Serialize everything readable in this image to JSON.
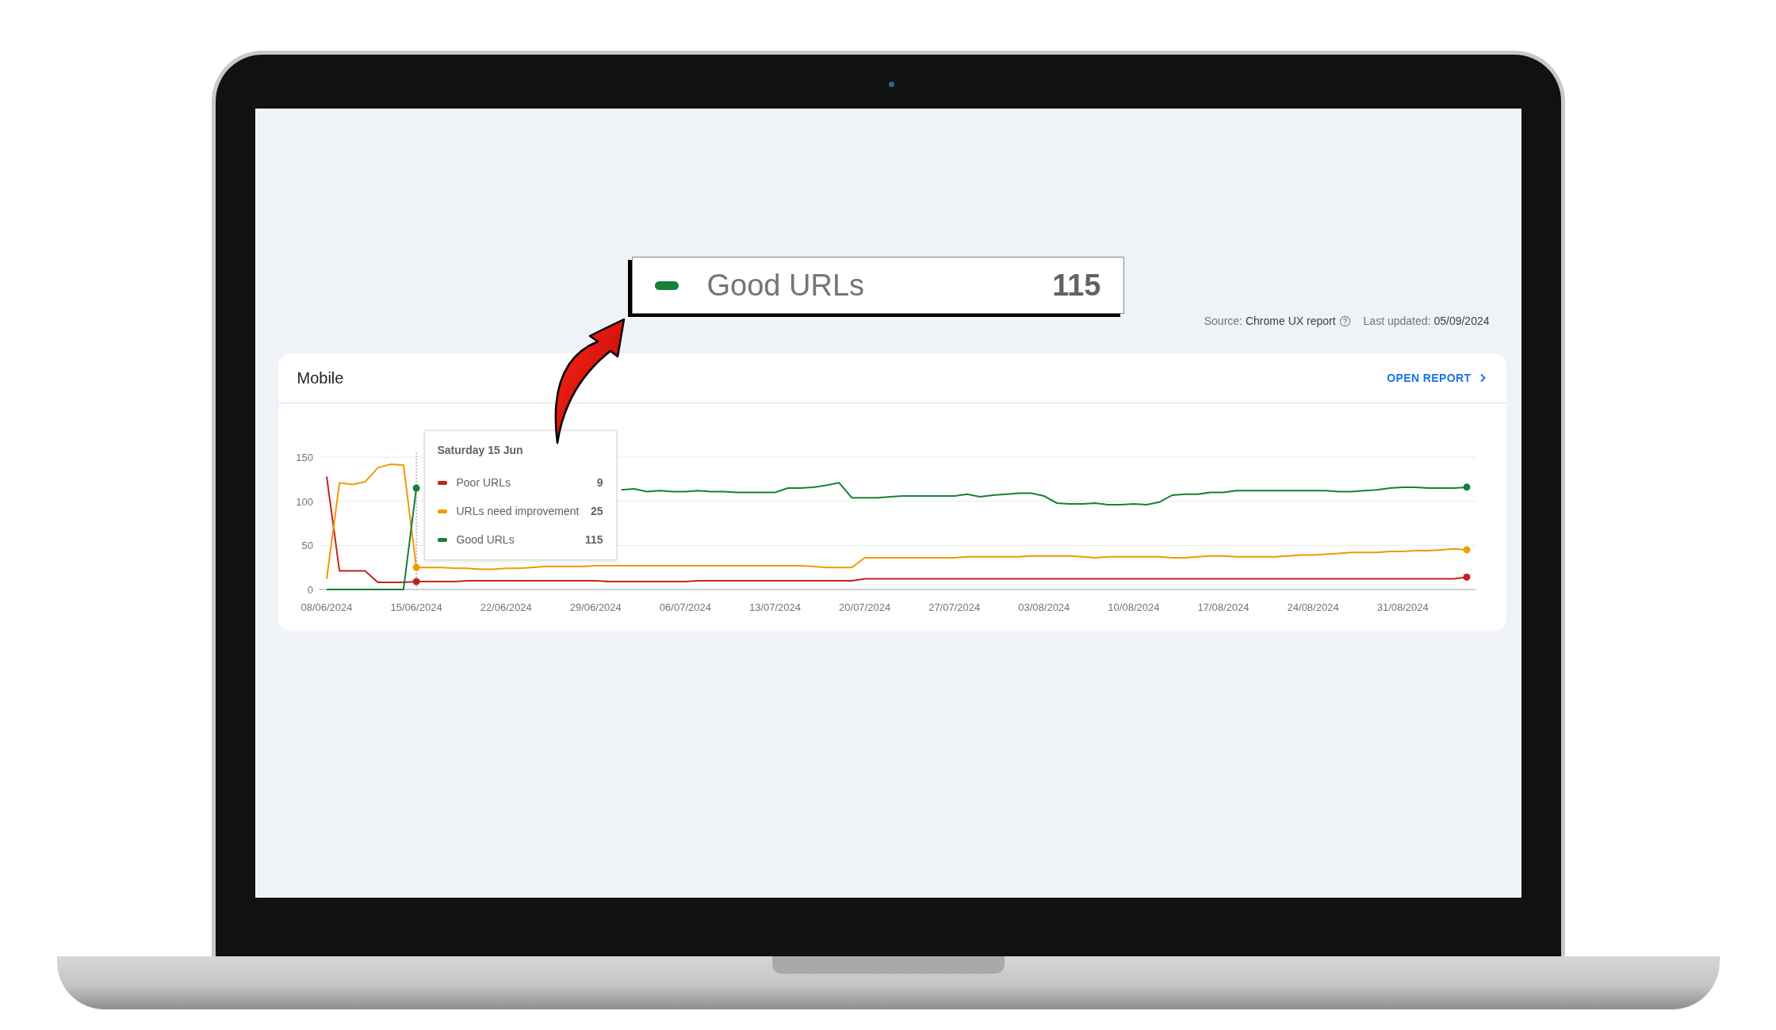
{
  "callout": {
    "label": "Good URLs",
    "value": "115"
  },
  "source": {
    "label": "Source:",
    "value": "Chrome UX report"
  },
  "updated": {
    "label": "Last updated:",
    "value": "05/09/2024"
  },
  "card": {
    "title": "Mobile",
    "link": "OPEN REPORT",
    "chart_data": {
      "type": "line",
      "categories": [
        "08/06/2024",
        null,
        null,
        null,
        null,
        null,
        null,
        "15/06/2024",
        null,
        null,
        null,
        null,
        null,
        null,
        "22/06/2024",
        null,
        null,
        null,
        null,
        null,
        null,
        "29/06/2024",
        null,
        null,
        null,
        null,
        null,
        null,
        "06/07/2024",
        null,
        null,
        null,
        null,
        null,
        null,
        "13/07/2024",
        null,
        null,
        null,
        null,
        null,
        null,
        "20/07/2024",
        null,
        null,
        null,
        null,
        null,
        null,
        "27/07/2024",
        null,
        null,
        null,
        null,
        null,
        null,
        "03/08/2024",
        null,
        null,
        null,
        null,
        null,
        null,
        "10/08/2024",
        null,
        null,
        null,
        null,
        null,
        null,
        "17/08/2024",
        null,
        null,
        null,
        null,
        null,
        null,
        "24/08/2024",
        null,
        null,
        null,
        null,
        null,
        null,
        "31/08/2024",
        null,
        null,
        null,
        null,
        null
      ],
      "ylim": [
        0,
        150
      ],
      "yticks": [
        0,
        50,
        100,
        150
      ],
      "series": [
        {
          "name": "Poor URLs",
          "color": "#c5221f",
          "values": [
            128,
            21,
            21,
            21,
            8,
            8,
            8,
            9,
            9,
            9,
            9,
            10,
            10,
            10,
            10,
            10,
            10,
            10,
            10,
            10,
            10,
            10,
            9,
            9,
            9,
            9,
            9,
            9,
            9,
            10,
            10,
            10,
            10,
            10,
            10,
            10,
            10,
            10,
            10,
            10,
            10,
            10,
            12,
            12,
            12,
            12,
            12,
            12,
            12,
            12,
            12,
            12,
            12,
            12,
            12,
            12,
            12,
            12,
            12,
            12,
            12,
            12,
            12,
            12,
            12,
            12,
            12,
            12,
            12,
            12,
            12,
            12,
            12,
            12,
            12,
            12,
            12,
            12,
            12,
            12,
            12,
            12,
            12,
            12,
            12,
            12,
            12,
            12,
            12,
            14
          ]
        },
        {
          "name": "URLs need improvement",
          "color": "#f29900",
          "values": [
            12,
            121,
            119,
            122,
            138,
            142,
            141,
            25,
            25,
            25,
            24,
            24,
            23,
            23,
            24,
            24,
            25,
            26,
            26,
            26,
            26,
            27,
            27,
            27,
            27,
            27,
            27,
            27,
            27,
            27,
            27,
            27,
            27,
            27,
            27,
            27,
            27,
            27,
            26,
            25,
            25,
            25,
            36,
            36,
            36,
            36,
            36,
            36,
            36,
            36,
            37,
            37,
            37,
            37,
            37,
            38,
            38,
            38,
            38,
            37,
            36,
            37,
            37,
            37,
            37,
            37,
            36,
            36,
            37,
            38,
            38,
            37,
            37,
            37,
            37,
            38,
            39,
            39,
            40,
            41,
            42,
            42,
            42,
            43,
            43,
            44,
            44,
            45,
            46,
            45
          ]
        },
        {
          "name": "Good URLs",
          "color": "#188038",
          "values": [
            0,
            0,
            0,
            0,
            0,
            0,
            0,
            115,
            null,
            null,
            null,
            null,
            null,
            null,
            null,
            null,
            null,
            null,
            null,
            null,
            null,
            null,
            null,
            113,
            114,
            111,
            112,
            111,
            111,
            112,
            111,
            111,
            110,
            110,
            110,
            110,
            115,
            115,
            116,
            118,
            121,
            104,
            104,
            104,
            105,
            106,
            106,
            106,
            106,
            106,
            108,
            105,
            107,
            108,
            109,
            109,
            106,
            98,
            97,
            97,
            98,
            96,
            96,
            97,
            96,
            99,
            107,
            108,
            108,
            110,
            110,
            112,
            112,
            112,
            112,
            112,
            112,
            112,
            112,
            111,
            111,
            112,
            113,
            115,
            116,
            116,
            115,
            115,
            115,
            116
          ]
        }
      ],
      "ref_lines": [
        {
          "axis": "x",
          "value": "15/06/2024"
        }
      ]
    },
    "tooltip": {
      "title": "Saturday 15 Jun",
      "rows": [
        {
          "value": "9"
        },
        {
          "value": "25"
        },
        {
          "value": "115"
        }
      ]
    }
  }
}
